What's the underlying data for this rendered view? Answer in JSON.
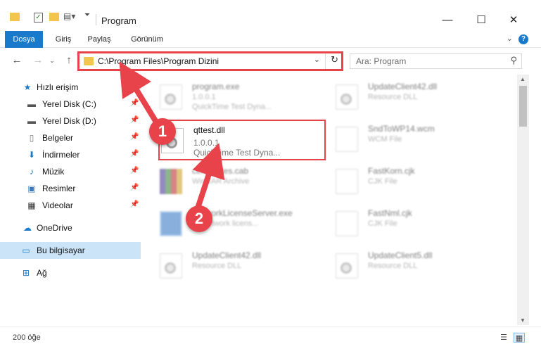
{
  "window": {
    "title": "Program",
    "minimize_label": "—",
    "maximize_label": "☐",
    "close_label": "✕"
  },
  "ribbon": {
    "tabs": [
      {
        "label": "Dosya",
        "active": true
      },
      {
        "label": "Giriş",
        "active": false
      },
      {
        "label": "Paylaş",
        "active": false
      },
      {
        "label": "Görünüm",
        "active": false
      }
    ],
    "help_label": "?"
  },
  "navigation": {
    "address_path": "C:\\Program Files\\Program Dizini",
    "search_placeholder": "Ara: Program"
  },
  "sidebar": {
    "items": [
      {
        "label": "Hızlı erişim",
        "icon": "star-icon",
        "pinned": false
      },
      {
        "label": "Yerel Disk (C:)",
        "icon": "drive-icon",
        "pinned": true
      },
      {
        "label": "Yerel Disk (D:)",
        "icon": "drive-icon",
        "pinned": true
      },
      {
        "label": "Belgeler",
        "icon": "document-icon",
        "pinned": true
      },
      {
        "label": "İndirmeler",
        "icon": "download-icon",
        "pinned": true
      },
      {
        "label": "Müzik",
        "icon": "music-icon",
        "pinned": true
      },
      {
        "label": "Resimler",
        "icon": "picture-icon",
        "pinned": true
      },
      {
        "label": "Videolar",
        "icon": "film-icon",
        "pinned": true
      },
      {
        "label": "OneDrive",
        "icon": "cloud-icon",
        "pinned": false
      },
      {
        "label": "Bu bilgisayar",
        "icon": "computer-icon",
        "pinned": false,
        "selected": true
      },
      {
        "label": "Ağ",
        "icon": "network-icon",
        "pinned": false
      }
    ]
  },
  "files": [
    {
      "name": "program.exe",
      "version": "1.0.0.1",
      "desc": "QuickTime Test Dyna...",
      "icon": "exe-icon"
    },
    {
      "name": "UpdateClient42.dll",
      "version": "",
      "desc": "Resource DLL",
      "icon": "dll-icon"
    },
    {
      "name": "qttest.dll",
      "version": "1.0.0.1",
      "desc": "QuickTime Test Dyna...",
      "icon": "dll-icon",
      "highlighted": true
    },
    {
      "name": "SndToWP14.wcm",
      "version": "",
      "desc": "WCM File",
      "icon": "file-icon"
    },
    {
      "name": "certificates.cab",
      "version": "",
      "desc": "WinRAR Archive",
      "icon": "archive-icon"
    },
    {
      "name": "FastKorn.cjk",
      "version": "",
      "desc": "CJK File",
      "icon": "file-icon"
    },
    {
      "name": "NetworkLicenseServer.exe",
      "version": "",
      "desc": "LY network licens...",
      "icon": "network-exe-icon"
    },
    {
      "name": "FastNml.cjk",
      "version": "",
      "desc": "CJK File",
      "icon": "file-icon"
    },
    {
      "name": "UpdateClient42.dll",
      "version": "",
      "desc": "Resource DLL",
      "icon": "dll-icon"
    },
    {
      "name": "UpdateClient5.dll",
      "version": "",
      "desc": "Resource DLL",
      "icon": "dll-icon"
    }
  ],
  "status": {
    "item_count": "200 öğe"
  },
  "annotations": {
    "step1": "1",
    "step2": "2",
    "color": "#e8424a"
  }
}
